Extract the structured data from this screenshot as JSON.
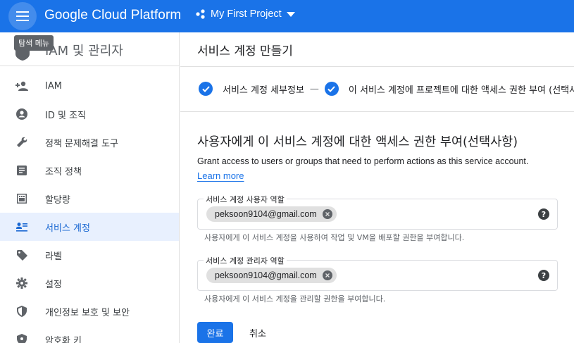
{
  "topbar": {
    "brand": "Google Cloud Platform",
    "project_name": "My First Project",
    "color": "#1a73e8"
  },
  "tooltip": {
    "text": "탐색 메뉴"
  },
  "sidebar": {
    "title": "IAM 및 관리자",
    "items": [
      {
        "label": "IAM",
        "icon": "person-add-icon"
      },
      {
        "label": "ID 및 조직",
        "icon": "account-circle-icon"
      },
      {
        "label": "정책 문제해결 도구",
        "icon": "wrench-icon"
      },
      {
        "label": "조직 정책",
        "icon": "article-icon"
      },
      {
        "label": "할당량",
        "icon": "quota-icon"
      },
      {
        "label": "서비스 계정",
        "icon": "service-account-icon",
        "active": true
      },
      {
        "label": "라벨",
        "icon": "label-icon"
      },
      {
        "label": "설정",
        "icon": "gear-icon"
      },
      {
        "label": "개인정보 보호 및 보안",
        "icon": "shield-icon"
      },
      {
        "label": "암호화 키",
        "icon": "key-icon"
      }
    ]
  },
  "main": {
    "page_title": "서비스 계정 만들기",
    "steps": [
      {
        "label": "서비스 계정 세부정보"
      },
      {
        "label": "이 서비스 계정에 프로젝트에 대한 액세스 권한 부여 (선택사항)"
      }
    ],
    "section_title": "사용자에게 이 서비스 계정에 대한 액세스 권한 부여(선택사항)",
    "section_desc": "Grant access to users or groups that need to perform actions as this service account.",
    "learn_more": "Learn more",
    "user_role_field": {
      "legend": "서비스 계정 사용자 역할",
      "chip": "peksoon9104@gmail.com",
      "hint": "사용자에게 이 서비스 계정을 사용하여 작업 및 VM을 배포할 권한을 부여합니다."
    },
    "admin_role_field": {
      "legend": "서비스 계정 관리자 역할",
      "chip": "peksoon9104@gmail.com",
      "hint": "사용자에게 이 서비스 계정을 관리할 권한을 부여합니다."
    },
    "done_label": "완료",
    "cancel_label": "취소"
  }
}
